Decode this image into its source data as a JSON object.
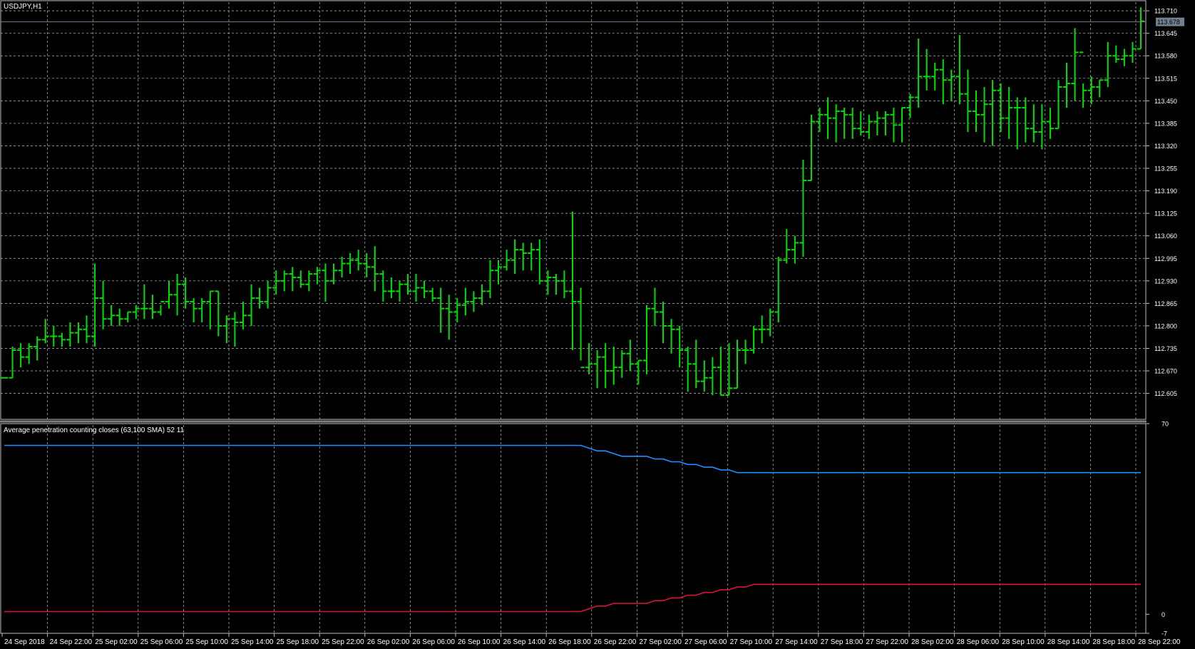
{
  "window": {
    "title": "USDJPY,H1"
  },
  "indicator": {
    "label": "Average penetration counting closes (63,100 SMA) 52 11"
  },
  "colors": {
    "background": "#000000",
    "grid": "#c0c0c0",
    "bars": "#00e000",
    "up_line": "#1e90ff",
    "down_line": "#dc143c",
    "axis_text": "#ffffff",
    "separator": "#808080",
    "current_price_line": "#708090",
    "current_price_box": "#708090"
  },
  "chart_data": [
    {
      "type": "ohlc",
      "symbol": "USDJPY",
      "timeframe": "H1",
      "current_price": 113.678,
      "current_price_label": "113.678",
      "ylim": [
        112.53,
        113.735
      ],
      "y_ticks": [
        "113.710",
        "113.645",
        "113.580",
        "113.515",
        "113.450",
        "113.385",
        "113.320",
        "113.255",
        "113.190",
        "113.125",
        "113.060",
        "112.995",
        "112.930",
        "112.865",
        "112.800",
        "112.735",
        "112.670",
        "112.605"
      ],
      "x_ticks": [
        "24 Sep 2018",
        "24 Sep 22:00",
        "25 Sep 02:00",
        "25 Sep 06:00",
        "25 Sep 10:00",
        "25 Sep 14:00",
        "25 Sep 18:00",
        "25 Sep 22:00",
        "26 Sep 02:00",
        "26 Sep 06:00",
        "26 Sep 10:00",
        "26 Sep 14:00",
        "26 Sep 18:00",
        "26 Sep 22:00",
        "27 Sep 02:00",
        "27 Sep 06:00",
        "27 Sep 10:00",
        "27 Sep 14:00",
        "27 Sep 18:00",
        "27 Sep 22:00",
        "28 Sep 02:00",
        "28 Sep 06:00",
        "28 Sep 10:00",
        "28 Sep 14:00",
        "28 Sep 18:00",
        "28 Sep 22:00"
      ],
      "bars": [
        [
          112.65,
          112.65,
          112.65,
          112.65
        ],
        [
          112.65,
          112.74,
          112.65,
          112.73
        ],
        [
          112.73,
          112.75,
          112.68,
          112.71
        ],
        [
          112.71,
          112.75,
          112.69,
          112.74
        ],
        [
          112.74,
          112.77,
          112.7,
          112.76
        ],
        [
          112.76,
          112.82,
          112.75,
          112.77
        ],
        [
          112.77,
          112.8,
          112.74,
          112.77
        ],
        [
          112.77,
          112.78,
          112.74,
          112.76
        ],
        [
          112.76,
          112.81,
          112.74,
          112.78
        ],
        [
          112.78,
          112.81,
          112.75,
          112.79
        ],
        [
          112.79,
          112.83,
          112.75,
          112.77
        ],
        [
          112.77,
          112.98,
          112.74,
          112.88
        ],
        [
          112.88,
          112.93,
          112.79,
          112.82
        ],
        [
          112.82,
          112.86,
          112.8,
          112.83
        ],
        [
          112.83,
          112.85,
          112.8,
          112.82
        ],
        [
          112.82,
          112.84,
          112.81,
          112.84
        ],
        [
          112.84,
          112.86,
          112.82,
          112.85
        ],
        [
          112.85,
          112.92,
          112.82,
          112.85
        ],
        [
          112.85,
          112.89,
          112.82,
          112.84
        ],
        [
          112.84,
          112.86,
          112.83,
          112.87
        ],
        [
          112.87,
          112.93,
          112.85,
          112.89
        ],
        [
          112.89,
          112.95,
          112.83,
          112.92
        ],
        [
          112.92,
          112.94,
          112.85,
          112.87
        ],
        [
          112.87,
          112.88,
          112.81,
          112.85
        ],
        [
          112.85,
          112.88,
          112.81,
          112.87
        ],
        [
          112.87,
          112.9,
          112.79,
          112.9
        ],
        [
          112.9,
          112.9,
          112.77,
          112.8
        ],
        [
          112.8,
          112.83,
          112.75,
          112.82
        ],
        [
          112.82,
          112.84,
          112.74,
          112.81
        ],
        [
          112.81,
          112.87,
          112.79,
          112.83
        ],
        [
          112.83,
          112.92,
          112.8,
          112.88
        ],
        [
          112.88,
          112.91,
          112.85,
          112.87
        ],
        [
          112.87,
          112.93,
          112.85,
          112.91
        ],
        [
          112.91,
          112.96,
          112.89,
          112.93
        ],
        [
          112.93,
          112.96,
          112.9,
          112.95
        ],
        [
          112.95,
          112.97,
          112.9,
          112.94
        ],
        [
          112.94,
          112.96,
          112.91,
          112.92
        ],
        [
          112.92,
          112.96,
          112.9,
          112.95
        ],
        [
          112.95,
          112.97,
          112.92,
          112.96
        ],
        [
          112.96,
          112.98,
          112.87,
          112.93
        ],
        [
          112.93,
          112.98,
          112.92,
          112.96
        ],
        [
          112.96,
          113.0,
          112.94,
          112.98
        ],
        [
          112.98,
          113.01,
          112.95,
          112.99
        ],
        [
          112.99,
          113.02,
          112.96,
          112.98
        ],
        [
          112.98,
          113.01,
          112.94,
          112.97
        ],
        [
          112.97,
          113.03,
          112.9,
          112.95
        ],
        [
          112.95,
          112.96,
          112.87,
          112.9
        ],
        [
          112.9,
          112.94,
          112.88,
          112.9
        ],
        [
          112.9,
          112.93,
          112.87,
          112.92
        ],
        [
          112.92,
          112.95,
          112.89,
          112.9
        ],
        [
          112.9,
          112.95,
          112.87,
          112.91
        ],
        [
          112.91,
          112.93,
          112.88,
          112.9
        ],
        [
          112.9,
          112.91,
          112.87,
          112.88
        ],
        [
          112.88,
          112.91,
          112.78,
          112.85
        ],
        [
          112.85,
          112.89,
          112.76,
          112.84
        ],
        [
          112.84,
          112.88,
          112.81,
          112.86
        ],
        [
          112.86,
          112.91,
          112.83,
          112.87
        ],
        [
          112.87,
          112.9,
          112.84,
          112.88
        ],
        [
          112.88,
          112.92,
          112.86,
          112.9
        ],
        [
          112.9,
          112.99,
          112.88,
          112.96
        ],
        [
          112.96,
          112.99,
          112.92,
          112.97
        ],
        [
          112.97,
          113.02,
          112.96,
          112.99
        ],
        [
          112.99,
          113.05,
          112.95,
          113.02
        ],
        [
          113.02,
          113.04,
          112.96,
          113.01
        ],
        [
          113.01,
          113.04,
          112.96,
          113.02
        ],
        [
          113.02,
          113.05,
          112.92,
          112.93
        ],
        [
          112.93,
          112.96,
          112.89,
          112.94
        ],
        [
          112.94,
          112.95,
          112.89,
          112.93
        ],
        [
          112.93,
          112.96,
          112.88,
          112.9
        ],
        [
          112.9,
          113.13,
          112.73,
          112.87
        ],
        [
          112.87,
          112.91,
          112.7,
          112.68
        ],
        [
          112.68,
          112.75,
          112.66,
          112.69
        ],
        [
          112.69,
          112.73,
          112.62,
          112.71
        ],
        [
          112.71,
          112.75,
          112.62,
          112.67
        ],
        [
          112.67,
          112.74,
          112.63,
          112.68
        ],
        [
          112.68,
          112.73,
          112.65,
          112.72
        ],
        [
          112.72,
          112.76,
          112.67,
          112.69
        ],
        [
          112.69,
          112.7,
          112.63,
          112.7
        ],
        [
          112.7,
          112.86,
          112.66,
          112.85
        ],
        [
          112.85,
          112.91,
          112.8,
          112.84
        ],
        [
          112.84,
          112.87,
          112.75,
          112.8
        ],
        [
          112.8,
          112.82,
          112.72,
          112.79
        ],
        [
          112.79,
          112.8,
          112.68,
          112.73
        ],
        [
          112.73,
          112.74,
          112.61,
          112.69
        ],
        [
          112.69,
          112.76,
          112.62,
          112.64
        ],
        [
          112.64,
          112.7,
          112.61,
          112.65
        ],
        [
          112.65,
          112.71,
          112.6,
          112.68
        ],
        [
          112.68,
          112.74,
          112.6,
          112.6
        ],
        [
          112.6,
          112.75,
          112.6,
          112.62
        ],
        [
          112.62,
          112.76,
          112.62,
          112.73
        ],
        [
          112.73,
          112.76,
          112.69,
          112.73
        ],
        [
          112.73,
          112.8,
          112.72,
          112.79
        ],
        [
          112.79,
          112.83,
          112.75,
          112.79
        ],
        [
          112.79,
          112.85,
          112.77,
          112.84
        ],
        [
          112.84,
          113.0,
          112.81,
          112.99
        ],
        [
          112.99,
          113.08,
          112.98,
          113.02
        ],
        [
          113.02,
          113.06,
          112.98,
          113.04
        ],
        [
          113.04,
          113.28,
          113.0,
          113.22
        ],
        [
          113.22,
          113.41,
          113.22,
          113.39
        ],
        [
          113.39,
          113.43,
          113.36,
          113.41
        ],
        [
          113.41,
          113.46,
          113.34,
          113.4
        ],
        [
          113.4,
          113.44,
          113.33,
          113.42
        ],
        [
          113.42,
          113.43,
          113.34,
          113.41
        ],
        [
          113.41,
          113.43,
          113.34,
          113.37
        ],
        [
          113.37,
          113.42,
          113.35,
          113.36
        ],
        [
          113.36,
          113.41,
          113.34,
          113.39
        ],
        [
          113.39,
          113.42,
          113.35,
          113.4
        ],
        [
          113.4,
          113.42,
          113.35,
          113.41
        ],
        [
          113.41,
          113.43,
          113.33,
          113.38
        ],
        [
          113.38,
          113.43,
          113.33,
          113.43
        ],
        [
          113.43,
          113.47,
          113.4,
          113.46
        ],
        [
          113.46,
          113.63,
          113.43,
          113.52
        ],
        [
          113.52,
          113.6,
          113.48,
          113.52
        ],
        [
          113.52,
          113.56,
          113.48,
          113.54
        ],
        [
          113.54,
          113.57,
          113.44,
          113.51
        ],
        [
          113.51,
          113.54,
          113.45,
          113.52
        ],
        [
          113.52,
          113.64,
          113.44,
          113.47
        ],
        [
          113.47,
          113.54,
          113.36,
          113.42
        ],
        [
          113.42,
          113.48,
          113.36,
          113.41
        ],
        [
          113.41,
          113.49,
          113.33,
          113.44
        ],
        [
          113.44,
          113.51,
          113.32,
          113.48
        ],
        [
          113.48,
          113.5,
          113.36,
          113.4
        ],
        [
          113.4,
          113.49,
          113.34,
          113.43
        ],
        [
          113.43,
          113.46,
          113.31,
          113.43
        ],
        [
          113.43,
          113.46,
          113.33,
          113.37
        ],
        [
          113.37,
          113.44,
          113.33,
          113.36
        ],
        [
          113.36,
          113.44,
          113.31,
          113.39
        ],
        [
          113.39,
          113.43,
          113.34,
          113.37
        ],
        [
          113.37,
          113.51,
          113.37,
          113.49
        ],
        [
          113.49,
          113.56,
          113.43,
          113.5
        ],
        [
          113.5,
          113.66,
          113.45,
          113.59
        ],
        [
          113.59,
          113.5,
          113.43,
          113.48
        ],
        [
          113.48,
          113.52,
          113.44,
          113.49
        ],
        [
          113.49,
          113.51,
          113.46,
          113.51
        ],
        [
          113.51,
          113.62,
          113.49,
          113.58
        ],
        [
          113.58,
          113.61,
          113.56,
          113.57
        ],
        [
          113.57,
          113.6,
          113.55,
          113.58
        ],
        [
          113.58,
          113.62,
          113.56,
          113.6
        ],
        [
          113.6,
          113.72,
          113.6,
          113.68
        ]
      ]
    },
    {
      "type": "line",
      "title": "Average penetration counting closes (63,100 SMA) 52 11",
      "ylim": [
        -7,
        70
      ],
      "y_ticks": [
        "70",
        "0",
        "-7"
      ],
      "series": [
        {
          "values": [
            62,
            62,
            62,
            62,
            62,
            62,
            62,
            62,
            62,
            62,
            62,
            62,
            62,
            62,
            62,
            62,
            62,
            62,
            62,
            62,
            62,
            62,
            62,
            62,
            62,
            62,
            62,
            62,
            62,
            62,
            62,
            62,
            62,
            62,
            62,
            62,
            62,
            62,
            62,
            62,
            62,
            62,
            62,
            62,
            62,
            62,
            62,
            62,
            62,
            62,
            62,
            62,
            62,
            62,
            62,
            62,
            62,
            62,
            62,
            62,
            62,
            62,
            62,
            62,
            62,
            62,
            62,
            62,
            62,
            62,
            62,
            61,
            60,
            60,
            59,
            58,
            58,
            58,
            58,
            57,
            57,
            56,
            56,
            55,
            55,
            54,
            54,
            53,
            53,
            52,
            52,
            52,
            52,
            52,
            52,
            52,
            52,
            52,
            52,
            52,
            52,
            52,
            52,
            52,
            52,
            52,
            52,
            52,
            52,
            52,
            52,
            52,
            52,
            52,
            52,
            52,
            52,
            52,
            52,
            52,
            52,
            52,
            52,
            52,
            52,
            52,
            52,
            52,
            52,
            52,
            52,
            52,
            52,
            52,
            52,
            52,
            52,
            52,
            52,
            52,
            52,
            52,
            52,
            52,
            52,
            52,
            52,
            52,
            52
          ]
        },
        {
          "values": [
            1,
            1,
            1,
            1,
            1,
            1,
            1,
            1,
            1,
            1,
            1,
            1,
            1,
            1,
            1,
            1,
            1,
            1,
            1,
            1,
            1,
            1,
            1,
            1,
            1,
            1,
            1,
            1,
            1,
            1,
            1,
            1,
            1,
            1,
            1,
            1,
            1,
            1,
            1,
            1,
            1,
            1,
            1,
            1,
            1,
            1,
            1,
            1,
            1,
            1,
            1,
            1,
            1,
            1,
            1,
            1,
            1,
            1,
            1,
            1,
            1,
            1,
            1,
            1,
            1,
            1,
            1,
            1,
            1,
            1,
            1,
            2,
            3,
            3,
            4,
            4,
            4,
            4,
            4,
            5,
            5,
            6,
            6,
            7,
            7,
            8,
            8,
            9,
            9,
            10,
            10,
            11,
            11,
            11,
            11,
            11,
            11,
            11,
            11,
            11,
            11,
            11,
            11,
            11,
            11,
            11,
            11,
            11,
            11,
            11,
            11,
            11,
            11,
            11,
            11,
            11,
            11,
            11,
            11,
            11,
            11,
            11,
            11,
            11,
            11,
            11,
            11,
            11,
            11,
            11,
            11,
            11,
            11,
            11,
            11,
            11,
            11,
            11,
            11,
            11,
            11,
            11,
            11,
            11,
            11,
            11,
            11,
            11
          ]
        }
      ]
    }
  ]
}
